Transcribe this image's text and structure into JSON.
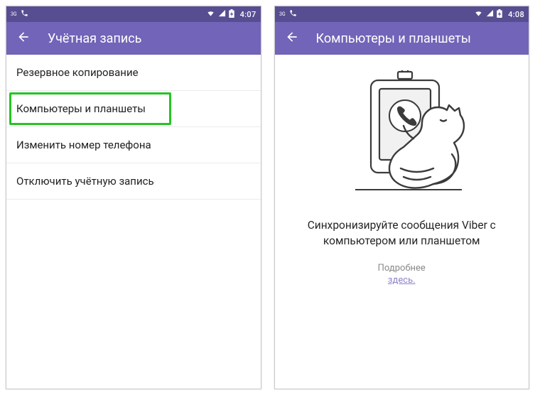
{
  "colors": {
    "appbar": "#7264b8",
    "statusbar": "#574e92",
    "highlight": "#27c423",
    "link": "#8d83c7"
  },
  "left": {
    "statusbar": {
      "clock": "4:07"
    },
    "appbar": {
      "title": "Учётная запись"
    },
    "menu": {
      "items": [
        {
          "label": "Резервное копирование",
          "highlighted": false
        },
        {
          "label": "Компьютеры и планшеты",
          "highlighted": true
        },
        {
          "label": "Изменить номер телефона",
          "highlighted": false
        },
        {
          "label": "Отключить учётную запись",
          "highlighted": false
        }
      ]
    }
  },
  "right": {
    "statusbar": {
      "clock": "4:08"
    },
    "appbar": {
      "title": "Компьютеры и планшеты"
    },
    "sync": {
      "title_line1": "Синхронизируйте сообщения Viber с",
      "title_line2": "компьютером или планшетом",
      "more_label": "Подробнее",
      "more_link": "здесь."
    }
  }
}
